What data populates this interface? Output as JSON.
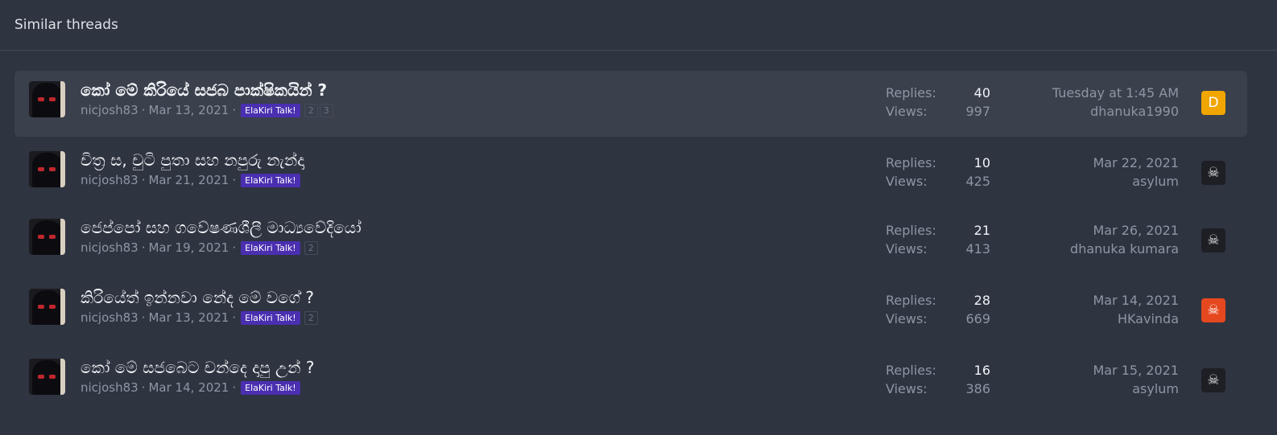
{
  "header": {
    "title": "Similar threads"
  },
  "threads": [
    {
      "title": "කෝ මේ කිරියේ සජබ පාක්ෂිකයින් ?",
      "author": "nicjosh83",
      "date": "Mar 13, 2021",
      "prefix": "ElaKiri Talk!",
      "pages": [
        "2",
        "3"
      ],
      "replies_label": "Replies:",
      "replies": "40",
      "views_label": "Views:",
      "views": "997",
      "last_date": "Tuesday at 1:45 AM",
      "last_user": "dhanuka1990",
      "last_avatar": "D",
      "last_avatar_icon": "letter-avatar"
    },
    {
      "title": "චිත්‍ර ස, චුටි පුතා සහ නපුරු නැන්දා",
      "author": "nicjosh83",
      "date": "Mar 21, 2021",
      "prefix": "ElaKiri Talk!",
      "pages": [],
      "replies_label": "Replies:",
      "replies": "10",
      "views_label": "Views:",
      "views": "425",
      "last_date": "Mar 22, 2021",
      "last_user": "asylum",
      "last_avatar": "☠",
      "last_avatar_icon": "skull-icon"
    },
    {
      "title": "ජෙප්පෝ සහ ගවේෂණශීලී මාධ්‍යවේදියෝ",
      "author": "nicjosh83",
      "date": "Mar 19, 2021",
      "prefix": "ElaKiri Talk!",
      "pages": [
        "2"
      ],
      "replies_label": "Replies:",
      "replies": "21",
      "views_label": "Views:",
      "views": "413",
      "last_date": "Mar 26, 2021",
      "last_user": "dhanuka kumara",
      "last_avatar": "☠",
      "last_avatar_icon": "masked-face-icon"
    },
    {
      "title": "කිරියේත් ඉන්නවා නේද මේ වගේ ?",
      "author": "nicjosh83",
      "date": "Mar 13, 2021",
      "prefix": "ElaKiri Talk!",
      "pages": [
        "2"
      ],
      "replies_label": "Replies:",
      "replies": "28",
      "views_label": "Views:",
      "views": "669",
      "last_date": "Mar 14, 2021",
      "last_user": "HKavinda",
      "last_avatar": "☠",
      "last_avatar_icon": "skull-icon"
    },
    {
      "title": "කෝ මේ සජබෙට චන්දෙ දාපු උන් ?",
      "author": "nicjosh83",
      "date": "Mar 14, 2021",
      "prefix": "ElaKiri Talk!",
      "pages": [],
      "replies_label": "Replies:",
      "replies": "16",
      "views_label": "Views:",
      "views": "386",
      "last_date": "Mar 15, 2021",
      "last_user": "asylum",
      "last_avatar": "☠",
      "last_avatar_icon": "skull-icon"
    }
  ],
  "colors": {
    "background": "#2f3441",
    "highlight_row": "#3a404c",
    "prefix_label": "#4a2fb0",
    "avatar_d": "#f0a500",
    "avatar_red": "#e5481f"
  }
}
